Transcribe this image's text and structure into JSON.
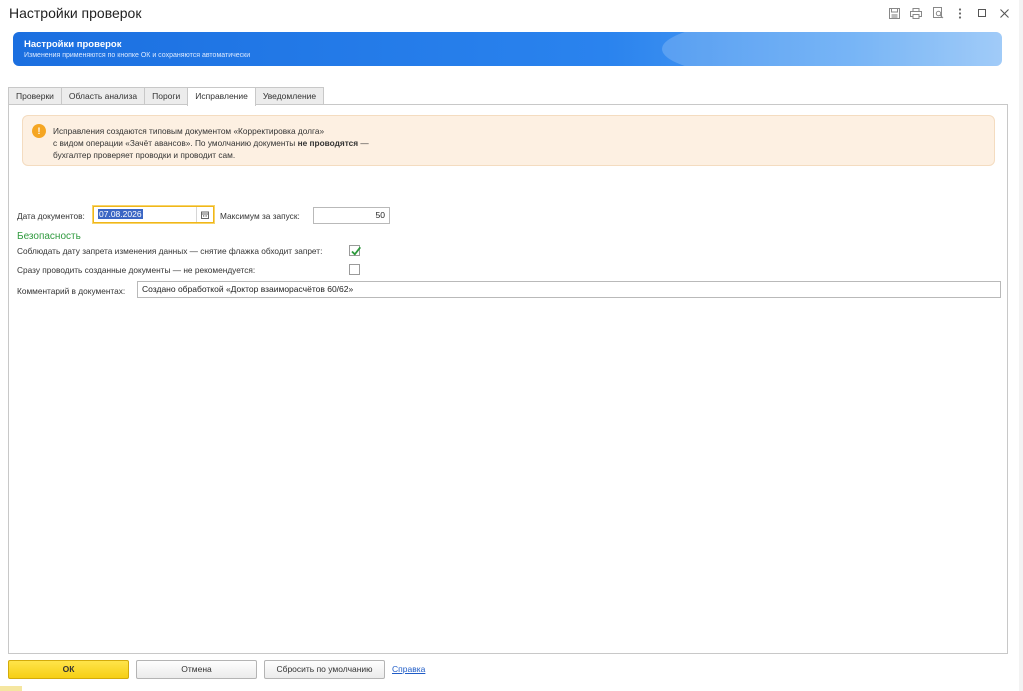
{
  "window": {
    "title": "Настройки проверок",
    "icons": [
      "save-icon",
      "print-icon",
      "preview-icon",
      "more-icon",
      "maximize-icon",
      "close-icon"
    ]
  },
  "banner": {
    "title": "Настройки проверок",
    "subtitle": "Изменения применяются по кнопке ОК и сохраняются автоматически"
  },
  "tabs": [
    {
      "label": "Проверки",
      "active": false
    },
    {
      "label": "Область анализа",
      "active": false
    },
    {
      "label": "Пороги",
      "active": false
    },
    {
      "label": "Исправление",
      "active": true
    },
    {
      "label": "Уведомление",
      "active": false
    }
  ],
  "notice": {
    "icon_text": "!",
    "line1": "Исправления создаются типовым документом «Корректировка долга»",
    "line2_pre": "с видом операции «Зачёт авансов». По умолчанию документы ",
    "line2_bold": "не проводятся",
    "line2_post": " —",
    "line3": "бухгалтер проверяет проводки и проводит сам."
  },
  "form": {
    "date_label": "Дата документов:",
    "date_value": "07.08.2026",
    "max_label": "Максимум за запуск:",
    "max_value": "50",
    "security_heading": "Безопасность",
    "respect_lock_label": "Соблюдать дату запрета изменения данных — снятие флажка обходит запрет:",
    "respect_lock_checked": true,
    "post_now_label": "Сразу проводить созданные документы — не рекомендуется:",
    "post_now_checked": false,
    "comment_label": "Комментарий в документах:",
    "comment_value": "Создано обработкой «Доктор взаиморасчётов 60/62»"
  },
  "footer": {
    "ok_label": "ОК",
    "cancel_label": "Отмена",
    "reset_label": "Сбросить по умолчанию",
    "help_label": "Справка"
  },
  "colors": {
    "accent_blue": "#1b6fe0",
    "ok_yellow": "#f6cf14",
    "section_green": "#2f9a3e",
    "notice_bg": "#fdf0e2",
    "notice_icon": "#f5a623"
  }
}
